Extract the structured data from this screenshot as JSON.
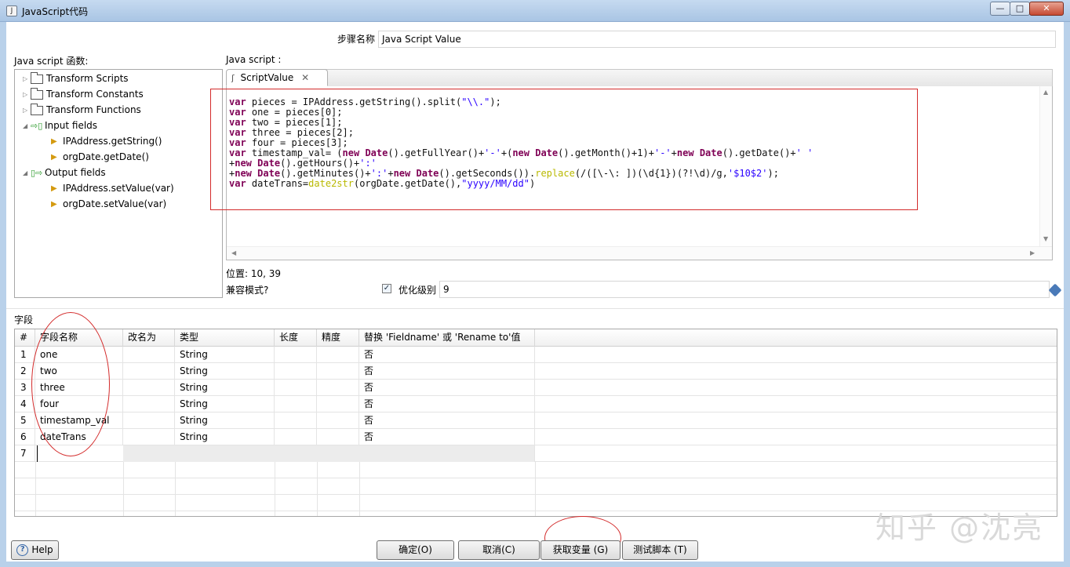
{
  "window": {
    "title": "JavaScript代码",
    "min": "—",
    "max": "□",
    "close": "✕"
  },
  "step": {
    "label": "步骤名称",
    "value": "Java Script Value"
  },
  "functions": {
    "label": "Java script 函数:",
    "tree": [
      {
        "label": "Transform Scripts",
        "type": "folder"
      },
      {
        "label": "Transform Constants",
        "type": "folder"
      },
      {
        "label": "Transform Functions",
        "type": "folder"
      },
      {
        "label": "Input fields",
        "type": "input"
      },
      {
        "label": "IPAddress.getString()",
        "type": "leaf"
      },
      {
        "label": "orgDate.getDate()",
        "type": "leaf"
      },
      {
        "label": "Output fields",
        "type": "output"
      },
      {
        "label": "IPAddress.setValue(var)",
        "type": "leaf"
      },
      {
        "label": "orgDate.setValue(var)",
        "type": "leaf"
      }
    ]
  },
  "script": {
    "label": "Java script :",
    "tab": "ScriptValue",
    "position_label": "位置: 10, 39"
  },
  "compat": {
    "label": "兼容模式?",
    "optimize_label": "优化级别",
    "optimize_value": "9",
    "checked_mark": "✓"
  },
  "fields": {
    "label": "字段",
    "columns": [
      "#",
      "字段名称",
      "改名为",
      "类型",
      "长度",
      "精度",
      "替换 'Fieldname' 或 'Rename to'值"
    ],
    "rows": [
      {
        "n": "1",
        "name": "one",
        "rename": "",
        "type": "String",
        "length": "",
        "precision": "",
        "replace": "否"
      },
      {
        "n": "2",
        "name": "two",
        "rename": "",
        "type": "String",
        "length": "",
        "precision": "",
        "replace": "否"
      },
      {
        "n": "3",
        "name": "three",
        "rename": "",
        "type": "String",
        "length": "",
        "precision": "",
        "replace": "否"
      },
      {
        "n": "4",
        "name": "four",
        "rename": "",
        "type": "String",
        "length": "",
        "precision": "",
        "replace": "否"
      },
      {
        "n": "5",
        "name": "timestamp_val",
        "rename": "",
        "type": "String",
        "length": "",
        "precision": "",
        "replace": "否"
      },
      {
        "n": "6",
        "name": "dateTrans",
        "rename": "",
        "type": "String",
        "length": "",
        "precision": "",
        "replace": "否"
      },
      {
        "n": "7",
        "name": "",
        "rename": "",
        "type": "",
        "length": "",
        "precision": "",
        "replace": ""
      }
    ]
  },
  "buttons": {
    "help": "Help",
    "ok": "确定(O)",
    "cancel": "取消(C)",
    "get_vars": "获取变量 (G)",
    "test": "测试脚本 (T)"
  },
  "watermark": "知乎 @沈亮",
  "colors": {
    "annotation_red": "#d32b2b",
    "keyword": "#7f0055",
    "function": "#b9b900",
    "string": "#2a00ff"
  }
}
